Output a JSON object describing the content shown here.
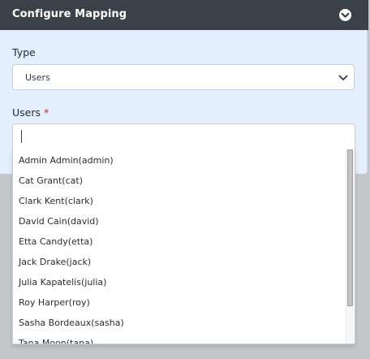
{
  "panel": {
    "title": "Configure Mapping",
    "collapse_icon": "chevron-circle-down-icon",
    "header_color": "#3b4148",
    "body_color": "#e3effc"
  },
  "type_field": {
    "label": "Type",
    "selected": "Users"
  },
  "users_field": {
    "label": "Users",
    "required_marker": "*",
    "input_value": "",
    "options": [
      "Admin Admin(admin)",
      "Cat Grant(cat)",
      "Clark Kent(clark)",
      "David Cain(david)",
      "Etta Candy(etta)",
      "Jack Drake(jack)",
      "Julia Kapatelis(julia)",
      "Roy Harper(roy)",
      "Sasha Bordeaux(sasha)",
      "Tana Moon(tana)"
    ]
  }
}
